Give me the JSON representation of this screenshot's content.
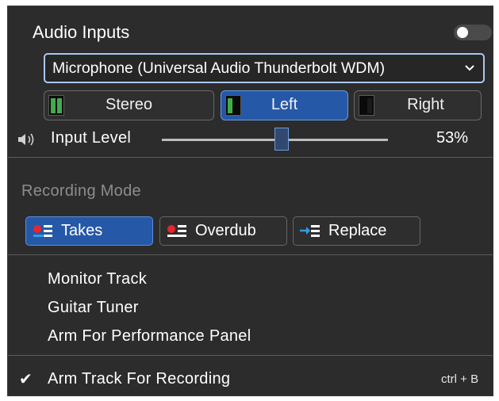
{
  "panel": {
    "title": "Audio Inputs",
    "toggle_state": "off"
  },
  "input": {
    "device": "Microphone (Universal Audio Thunderbolt WDM)",
    "channels": [
      {
        "label": "Stereo",
        "active": false
      },
      {
        "label": "Left",
        "active": true
      },
      {
        "label": "Right",
        "active": false
      }
    ],
    "level_label": "Input Level",
    "level_value": 53,
    "level_text": "53%"
  },
  "recording": {
    "label": "Recording Mode",
    "modes": [
      {
        "label": "Takes",
        "active": true,
        "icon": "takes-icon"
      },
      {
        "label": "Overdub",
        "active": false,
        "icon": "overdub-icon"
      },
      {
        "label": "Replace",
        "active": false,
        "icon": "replace-icon"
      }
    ]
  },
  "menu": {
    "items": [
      {
        "label": "Monitor Track"
      },
      {
        "label": "Guitar Tuner"
      },
      {
        "label": "Arm For Performance Panel"
      }
    ],
    "arm": {
      "label": "Arm Track For Recording",
      "checked": true,
      "check_glyph": "✔",
      "shortcut": "ctrl + B"
    }
  },
  "colors": {
    "accent": "#2658a8",
    "meter_green": "#3fae49",
    "record_red": "#e8262b",
    "replace_blue": "#2f9de6"
  }
}
